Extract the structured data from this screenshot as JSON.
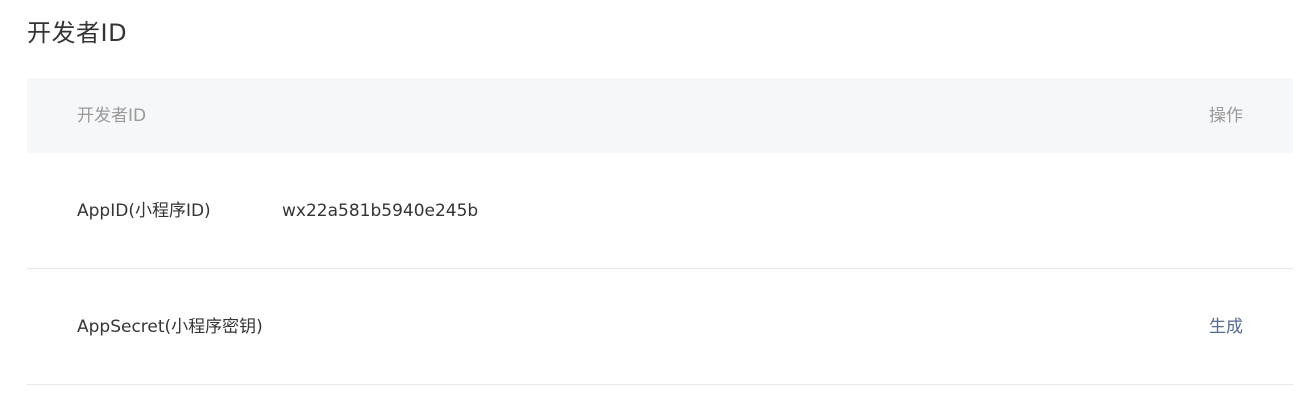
{
  "section": {
    "title": "开发者ID"
  },
  "table": {
    "headers": {
      "id": "开发者ID",
      "operation": "操作"
    },
    "rows": [
      {
        "label": "AppID(小程序ID)",
        "value": "wx22a581b5940e245b",
        "action": ""
      },
      {
        "label": "AppSecret(小程序密钥)",
        "value": "",
        "action": "生成"
      }
    ]
  },
  "colors": {
    "header_bg": "#f6f7f9",
    "link": "#576b95",
    "divider": "#e7e7eb",
    "text": "#353535",
    "muted_text": "#9a9a9a"
  }
}
